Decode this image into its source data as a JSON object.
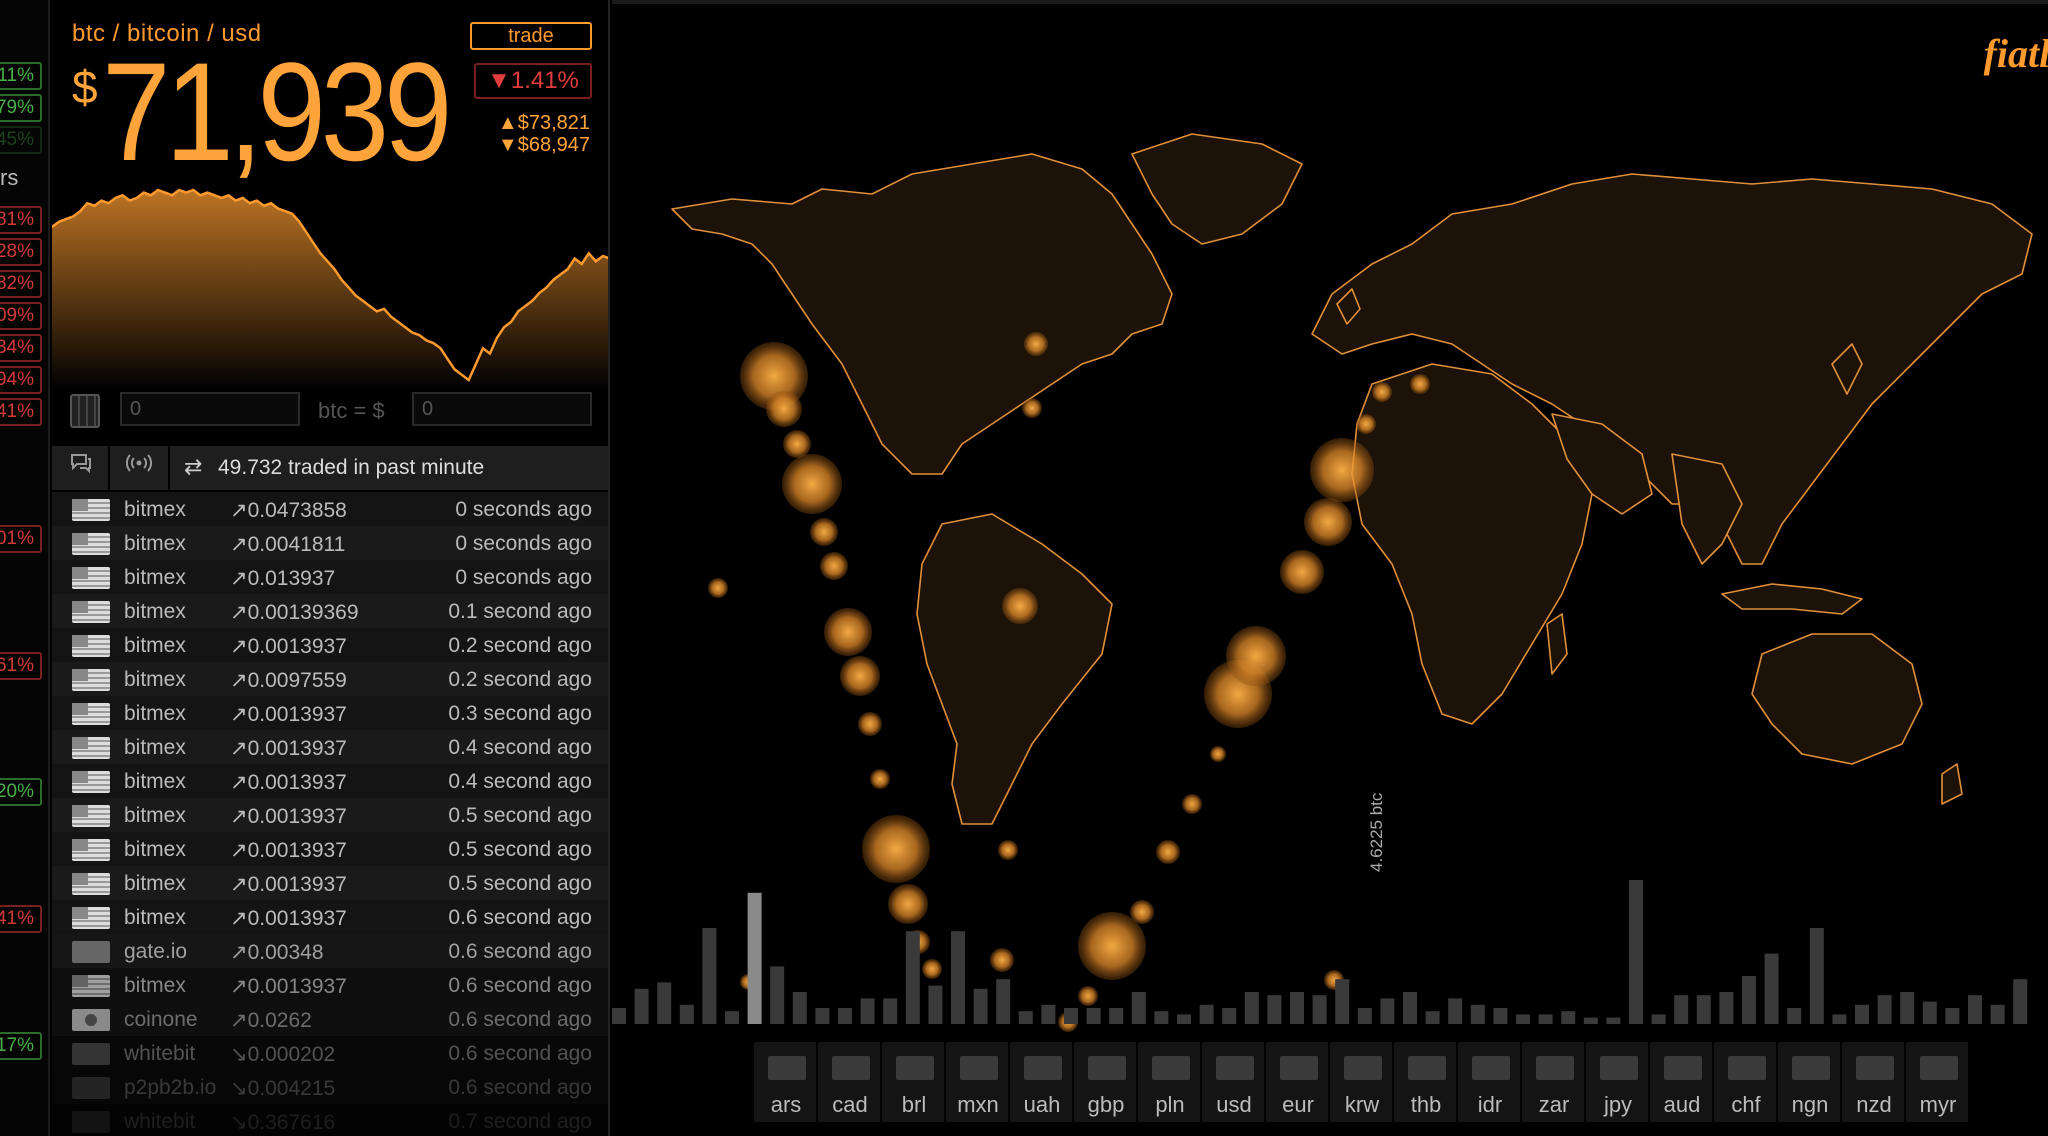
{
  "left_column": {
    "label": "rs",
    "percents": [
      {
        "text": "11%",
        "color": "green"
      },
      {
        "text": "79%",
        "color": "green"
      },
      {
        "text": "45%",
        "color": "green"
      },
      {
        "text": "81%",
        "color": "red"
      },
      {
        "text": "28%",
        "color": "red"
      },
      {
        "text": "82%",
        "color": "red"
      },
      {
        "text": "09%",
        "color": "red"
      },
      {
        "text": "34%",
        "color": "red"
      },
      {
        "text": "94%",
        "color": "red"
      },
      {
        "text": "41%",
        "color": "red"
      },
      {
        "text": "01%",
        "color": "red"
      },
      {
        "text": "61%",
        "color": "red"
      },
      {
        "text": "20%",
        "color": "green"
      },
      {
        "text": "41%",
        "color": "red"
      },
      {
        "text": "17%",
        "color": "green"
      }
    ]
  },
  "ticker": {
    "pair": "btc / bitcoin / usd",
    "trade_label": "trade",
    "currency_symbol": "$",
    "price": "71,939",
    "change": "▼1.41%",
    "high": "▲$73,821",
    "low": "▼$68,947",
    "accent": "#ffa43a",
    "down_color": "#e23c3c"
  },
  "chart_data": {
    "type": "area",
    "values": [
      58,
      60,
      61,
      62,
      64,
      67,
      66,
      68,
      67,
      69,
      70,
      68,
      69,
      71,
      70,
      72,
      71,
      70,
      72,
      71,
      72,
      70,
      71,
      70,
      69,
      70,
      68,
      69,
      67,
      68,
      66,
      67,
      65,
      64,
      63,
      60,
      56,
      52,
      48,
      45,
      42,
      38,
      35,
      32,
      30,
      28,
      26,
      27,
      24,
      22,
      20,
      18,
      17,
      15,
      14,
      12,
      8,
      4,
      2,
      0,
      6,
      12,
      10,
      16,
      20,
      22,
      26,
      28,
      30,
      33,
      35,
      38,
      40,
      42,
      46,
      44,
      48,
      45,
      47,
      46
    ],
    "color": "#ff9a2e"
  },
  "converter": {
    "btc_value": "0",
    "label": "btc = $",
    "usd_value": "0"
  },
  "trade_header": {
    "swap_icon": "swap-arrows-icon",
    "summary": "49.732  traded in past minute"
  },
  "trades": [
    {
      "flag": "us",
      "exchange": "bitmex",
      "amount": "↗0.0473858",
      "ago": "0 seconds ago"
    },
    {
      "flag": "us",
      "exchange": "bitmex",
      "amount": "↗0.0041811",
      "ago": "0 seconds ago"
    },
    {
      "flag": "us",
      "exchange": "bitmex",
      "amount": "↗0.013937",
      "ago": "0 seconds ago"
    },
    {
      "flag": "us",
      "exchange": "bitmex",
      "amount": "↗0.00139369",
      "ago": "0.1 second ago"
    },
    {
      "flag": "us",
      "exchange": "bitmex",
      "amount": "↗0.0013937",
      "ago": "0.2 second ago"
    },
    {
      "flag": "us",
      "exchange": "bitmex",
      "amount": "↗0.0097559",
      "ago": "0.2 second ago"
    },
    {
      "flag": "us",
      "exchange": "bitmex",
      "amount": "↗0.0013937",
      "ago": "0.3 second ago"
    },
    {
      "flag": "us",
      "exchange": "bitmex",
      "amount": "↗0.0013937",
      "ago": "0.4 second ago"
    },
    {
      "flag": "us",
      "exchange": "bitmex",
      "amount": "↗0.0013937",
      "ago": "0.4 second ago"
    },
    {
      "flag": "us",
      "exchange": "bitmex",
      "amount": "↗0.0013937",
      "ago": "0.5 second ago"
    },
    {
      "flag": "us",
      "exchange": "bitmex",
      "amount": "↗0.0013937",
      "ago": "0.5 second ago"
    },
    {
      "flag": "us",
      "exchange": "bitmex",
      "amount": "↗0.0013937",
      "ago": "0.5 second ago"
    },
    {
      "flag": "us",
      "exchange": "bitmex",
      "amount": "↗0.0013937",
      "ago": "0.6 second ago"
    },
    {
      "flag": "plain",
      "exchange": "gate.io",
      "amount": "↗0.00348",
      "ago": "0.6 second ago"
    },
    {
      "flag": "us",
      "exchange": "bitmex",
      "amount": "↗0.0013937",
      "ago": "0.6 second ago"
    },
    {
      "flag": "kr",
      "exchange": "coinone",
      "amount": "↗0.0262",
      "ago": "0.6 second ago"
    },
    {
      "flag": "plain",
      "exchange": "whitebit",
      "amount": "↘0.000202",
      "ago": "0.6 second ago"
    },
    {
      "flag": "plain",
      "exchange": "p2pb2b.io",
      "amount": "↘0.004215",
      "ago": "0.6 second ago"
    },
    {
      "flag": "plain",
      "exchange": "whitebit",
      "amount": "↘0.367616",
      "ago": "0.7 second ago"
    }
  ],
  "map": {
    "logo": "fiatle",
    "volume_label": "4.6225 btc",
    "volume_bars": [
      10,
      22,
      26,
      12,
      60,
      8,
      82,
      36,
      20,
      10,
      10,
      16,
      16,
      58,
      24,
      58,
      22,
      28,
      8,
      12,
      10,
      10,
      10,
      20,
      8,
      6,
      12,
      10,
      20,
      18,
      20,
      18,
      28,
      10,
      16,
      20,
      8,
      16,
      12,
      10,
      6,
      6,
      8,
      4,
      4,
      90,
      6,
      18,
      18,
      20,
      30,
      44,
      10,
      60,
      6,
      12,
      18,
      20,
      14,
      10,
      18,
      12,
      28
    ],
    "currencies": [
      "ars",
      "cad",
      "brl",
      "mxn",
      "uah",
      "gbp",
      "pln",
      "usd",
      "eur",
      "krw",
      "thb",
      "idr",
      "zar",
      "jpy",
      "aud",
      "chf",
      "ngn",
      "nzd",
      "myr"
    ]
  }
}
